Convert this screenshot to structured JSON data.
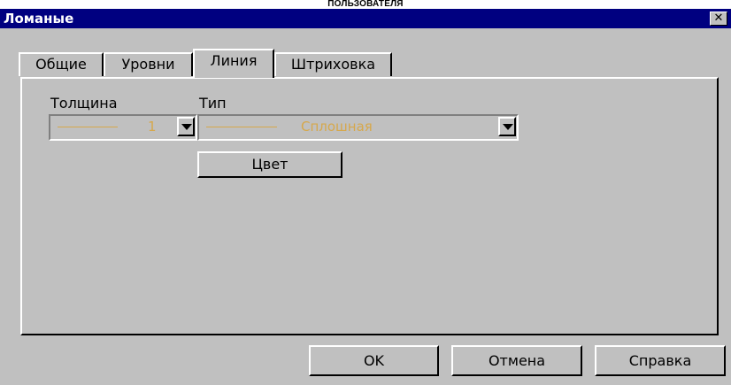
{
  "doc_fragment": "ПОЛЬЗОВАТЕЛЯ",
  "window": {
    "title": "Ломаные",
    "close_glyph": "✕"
  },
  "tabs": [
    {
      "label": "Общие"
    },
    {
      "label": "Уровни"
    },
    {
      "label": "Линия",
      "active": true
    },
    {
      "label": "Штриховка"
    }
  ],
  "fields": {
    "thickness": {
      "label": "Толщина",
      "value": "1"
    },
    "type": {
      "label": "Тип",
      "value": "Сплошная"
    },
    "color_button": "Цвет"
  },
  "buttons": {
    "ok": "OK",
    "cancel": "Отмена",
    "help": "Справка"
  },
  "colors": {
    "titlebar": "#000080",
    "face": "#c0c0c0",
    "disabled_text": "#d6a84c"
  }
}
